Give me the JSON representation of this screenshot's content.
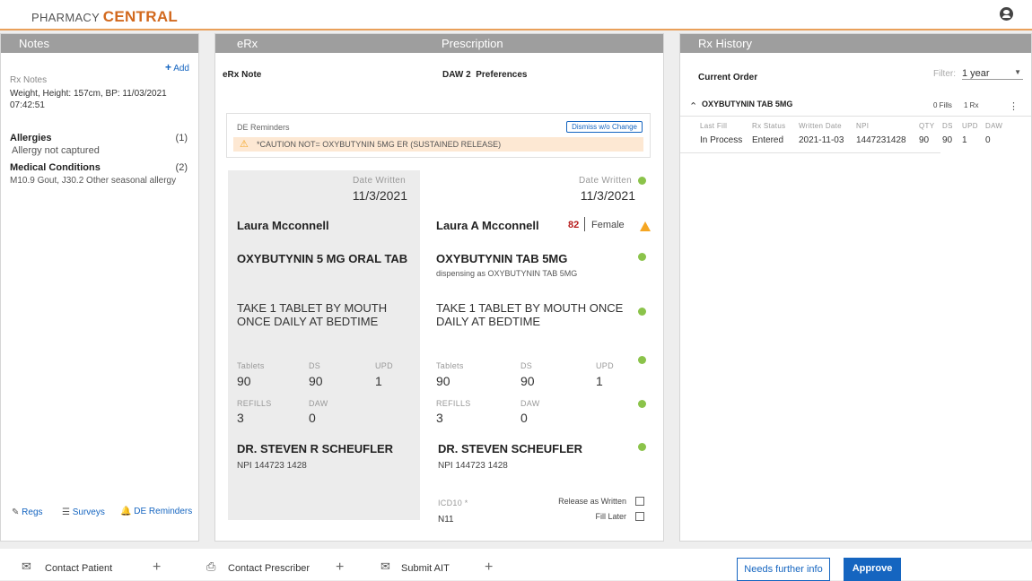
{
  "app": {
    "brand_light": "PHARMACY",
    "brand_bold": "CENTRAL"
  },
  "notes": {
    "title": "Notes",
    "add": "Add",
    "rx_notes_label": "Rx Notes",
    "rx_notes_text": "Weight, Height: 157cm, BP: 11/03/2021 07:42:51",
    "allergies_label": "Allergies",
    "allergies_count": "(1)",
    "allergies_value": "Allergy not captured",
    "conditions_label": "Medical Conditions",
    "conditions_count": "(2)",
    "conditions_value": "M10.9 Gout, J30.2 Other seasonal allergy",
    "regs": "Regs",
    "surveys": "Surveys",
    "de_reminders": "DE Reminders"
  },
  "erx": {
    "title": "eRx",
    "prescription_title": "Prescription",
    "erx_note": "eRx Note",
    "daw": "DAW 2",
    "preferences": "Preferences",
    "de_reminders_label": "DE Reminders",
    "dismiss": "Dismiss w/o Change",
    "caution": "*CAUTION NOT= OXYBUTYNIN 5MG ER (SUSTAINED RELEASE)",
    "left": {
      "date_label": "Date Written",
      "date": "11/3/2021",
      "patient": "Laura Mcconnell",
      "drug": "OXYBUTYNIN 5 MG ORAL TAB",
      "sig": "TAKE 1 TABLET BY MOUTH ONCE DAILY AT BEDTIME",
      "tablets_label": "Tablets",
      "tablets": "90",
      "ds_label": "DS",
      "ds": "90",
      "upd_label": "UPD",
      "upd": "1",
      "refills_label": "REFILLS",
      "refills": "3",
      "daw_label": "DAW",
      "daw": "0",
      "prescriber": "DR. STEVEN R SCHEUFLER",
      "npi": "NPI 144723 1428"
    },
    "right": {
      "date_label": "Date Written",
      "date": "11/3/2021",
      "patient": "Laura A Mcconnell",
      "age": "82",
      "gender": "Female",
      "drug": "OXYBUTYNIN TAB 5MG",
      "dispensing": "dispensing as OXYBUTYNIN TAB 5MG",
      "sig": "TAKE 1 TABLET BY MOUTH ONCE DAILY AT BEDTIME",
      "tablets_label": "Tablets",
      "tablets": "90",
      "ds_label": "DS",
      "ds": "90",
      "upd_label": "UPD",
      "upd": "1",
      "refills_label": "REFILLS",
      "refills": "3",
      "daw_label": "DAW",
      "daw": "0",
      "prescriber": "DR. STEVEN SCHEUFLER",
      "npi": "NPI 144723 1428",
      "icd_label": "ICD10 *",
      "icd": "N11",
      "release": "Release as Written",
      "fill_later": "Fill Later"
    }
  },
  "history": {
    "title": "Rx History",
    "current_order": "Current Order",
    "filter_label": "Filter:",
    "filter_value": "1 year",
    "drug": "OXYBUTYNIN TAB 5MG",
    "fills": "0 Fills",
    "rx": "1 Rx",
    "columns": [
      "Last Fill",
      "Rx Status",
      "Written Date",
      "NPI",
      "QTY",
      "DS",
      "UPD",
      "DAW"
    ],
    "row": [
      "In Process",
      "Entered",
      "2021-11-03",
      "1447231428",
      "90",
      "90",
      "1",
      "0"
    ]
  },
  "footer": {
    "contact_patient": "Contact Patient",
    "contact_prescriber": "Contact Prescriber",
    "submit_ait": "Submit AIT",
    "needs_info": "Needs further info",
    "approve": "Approve"
  }
}
